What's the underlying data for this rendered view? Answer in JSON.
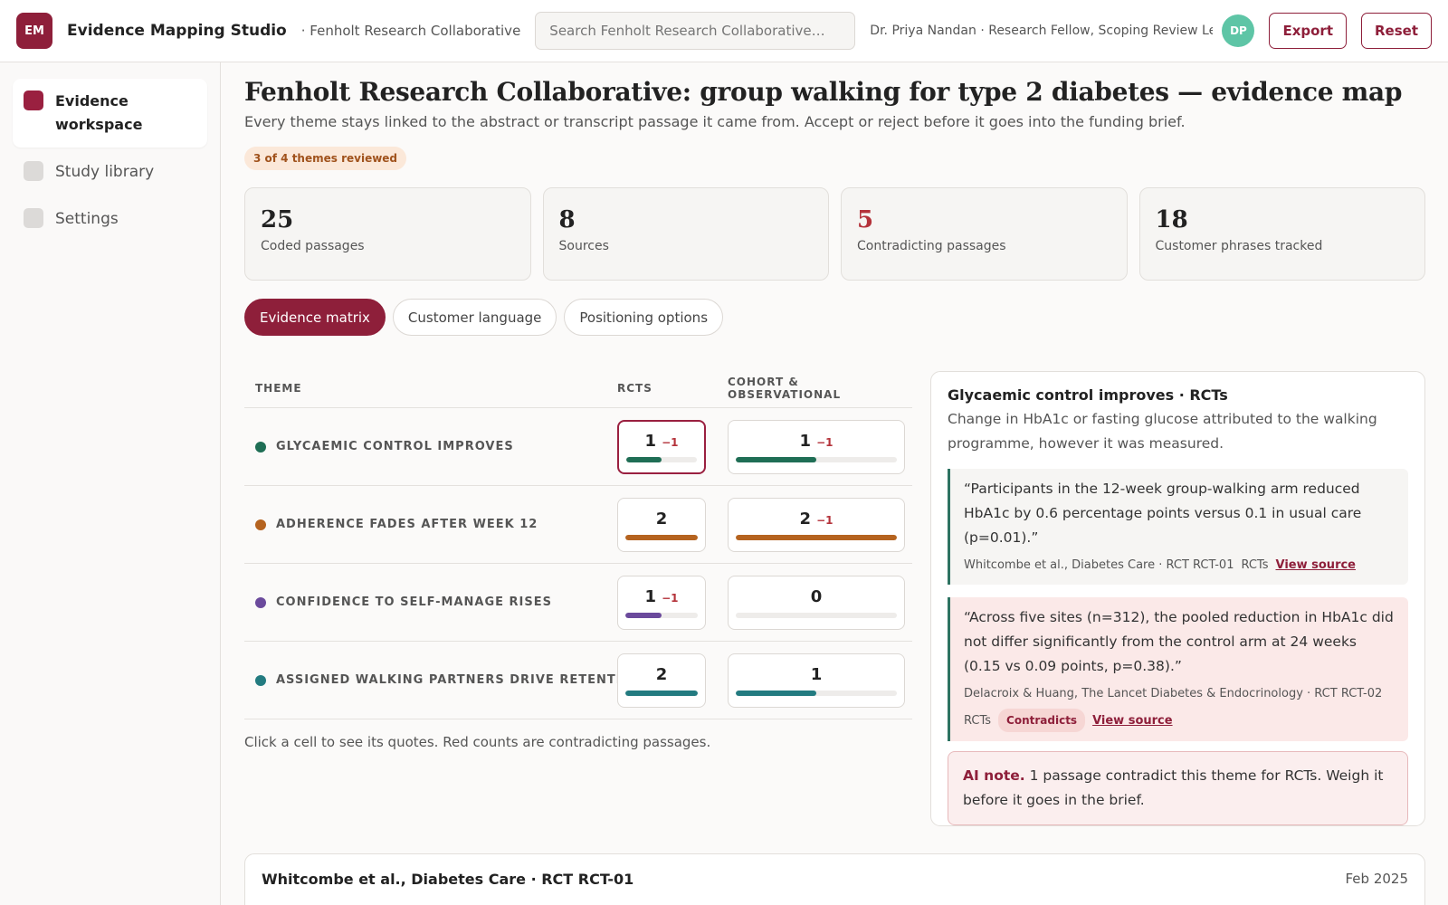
{
  "topbar": {
    "logo": "EM",
    "app_name": "Evidence Mapping Studio",
    "org": "· Fenholt Research Collaborative",
    "search_placeholder": "Search Fenholt Research Collaborative…",
    "user": "Dr. Priya Nandan · Research Fellow, Scoping Review Lead",
    "avatar": "DP",
    "export_label": "Export",
    "reset_label": "Reset"
  },
  "sidebar": {
    "items": [
      {
        "label": "Evidence workspace",
        "active": true
      },
      {
        "label": "Study library",
        "active": false
      },
      {
        "label": "Settings",
        "active": false
      }
    ]
  },
  "main": {
    "title": "Fenholt Research Collaborative: group walking for type 2 diabetes — evidence map",
    "subtitle": "Every theme stays linked to the abstract or transcript passage it came from. Accept or reject before it goes into the funding brief.",
    "badge": "3 of 4 themes reviewed",
    "stats": [
      {
        "value": "25",
        "label": "Coded passages"
      },
      {
        "value": "8",
        "label": "Sources"
      },
      {
        "value": "5",
        "label": "Contradicting passages"
      },
      {
        "value": "18",
        "label": "Customer phrases tracked"
      }
    ],
    "tabs": [
      "Evidence matrix",
      "Customer language",
      "Positioning options"
    ],
    "matrix": {
      "headers": [
        "THEME",
        "RCTS",
        "COHORT & OBSERVATIONAL"
      ],
      "rows": [
        {
          "theme": "GLYCAEMIC CONTROL IMPROVES",
          "color": "#1f6e55",
          "rct": {
            "count": "1",
            "neg": "−1",
            "fill": 0.5
          },
          "cohort": {
            "count": "1",
            "neg": "−1",
            "fill": 0.5
          }
        },
        {
          "theme": "ADHERENCE FADES AFTER WEEK 12",
          "color": "#b5631f",
          "rct": {
            "count": "2",
            "neg": "",
            "fill": 1.0
          },
          "cohort": {
            "count": "2",
            "neg": "−1",
            "fill": 1.0
          }
        },
        {
          "theme": "CONFIDENCE TO SELF-MANAGE RISES",
          "color": "#6b4a9c",
          "rct": {
            "count": "1",
            "neg": "−1",
            "fill": 0.5
          },
          "cohort": {
            "count": "0",
            "neg": "",
            "fill": 0
          }
        },
        {
          "theme": "ASSIGNED WALKING PARTNERS DRIVE RETENTION",
          "color": "#237b80",
          "rct": {
            "count": "2",
            "neg": "",
            "fill": 1.0
          },
          "cohort": {
            "count": "1",
            "neg": "",
            "fill": 0.5
          }
        }
      ],
      "hint": "Click a cell to see its quotes. Red counts are contradicting passages."
    },
    "detail": {
      "title": "Glycaemic control improves · RCTs",
      "description": "Change in HbA1c or fasting glucose attributed to the walking programme, however it was measured.",
      "quotes": [
        {
          "text": "“Participants in the 12-week group-walking arm reduced HbA1c by 0.6 percentage points versus 0.1 in usual care (p=0.01).”",
          "source": "Whitcombe et al., Diabetes Care · RCT RCT-01",
          "tag": "RCTs",
          "contradicts": "",
          "link": "View source"
        },
        {
          "text": "“Across five sites (n=312), the pooled reduction in HbA1c did not differ significantly from the control arm at 24 weeks (0.15 vs 0.09 points, p=0.38).”",
          "source": "Delacroix & Huang, The Lancet Diabetes & Endocrinology · RCT RCT-02",
          "tag": "RCTs",
          "contradicts": "Contradicts",
          "link": "View source"
        }
      ],
      "ai_label": "AI note.",
      "ai_text": "1 passage contradict this theme for RCTs. Weigh it before it goes in the brief."
    },
    "bottom_card": {
      "title": "Whitcombe et al., Diabetes Care · RCT RCT-01",
      "date": "Feb 2025"
    }
  }
}
